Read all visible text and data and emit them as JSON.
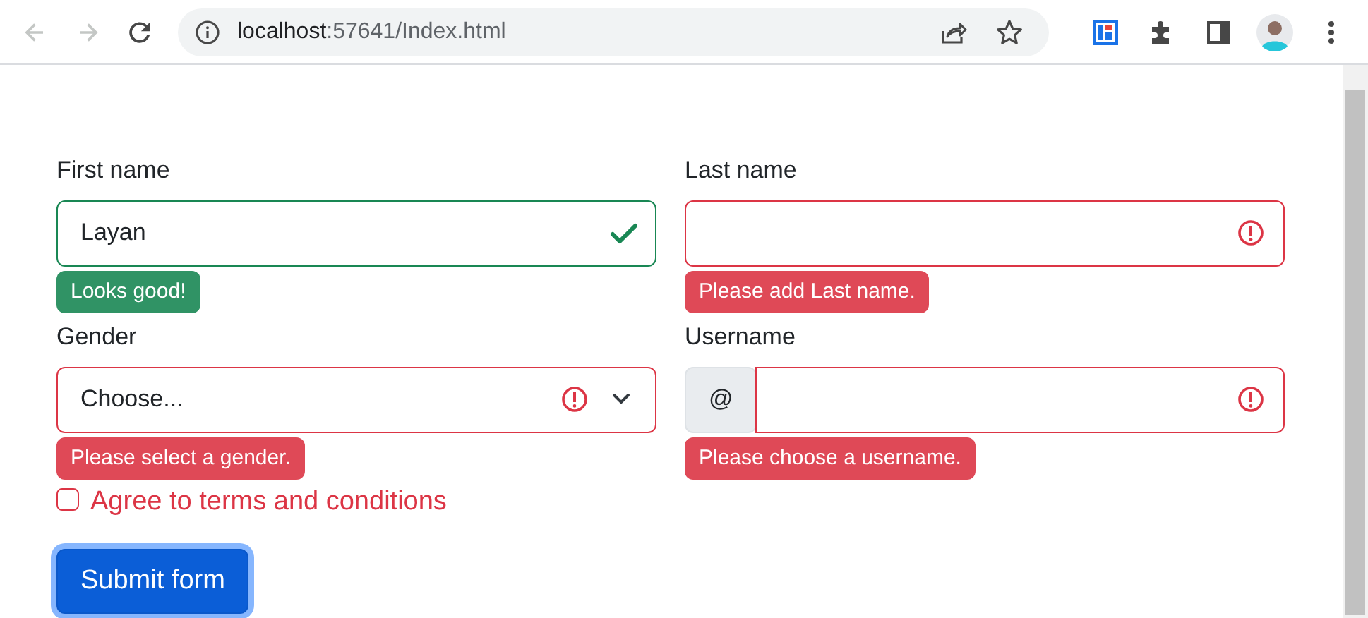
{
  "browser": {
    "back": {
      "disabled": true
    },
    "forward": {
      "disabled": true
    },
    "address": {
      "host": "localhost",
      "path": ":57641/Index.html"
    }
  },
  "form": {
    "fields": [
      {
        "kind": "text",
        "label": "First name",
        "value": "Layan",
        "valid": true,
        "feedback": "Looks good!"
      },
      {
        "kind": "text",
        "label": "Last name",
        "valid": false,
        "feedback": "Please add Last name."
      },
      {
        "kind": "select",
        "label": "Gender",
        "value": "Choose...",
        "valid": false,
        "feedback": "Please select a gender."
      },
      {
        "kind": "prefixed",
        "label": "Username",
        "prefix": "@",
        "valid": false,
        "feedback": "Please choose a username."
      }
    ],
    "checkbox": {
      "label": "Agree to terms and conditions",
      "checked": false,
      "valid": false
    },
    "submit": {
      "label": "Submit form",
      "focused": true
    }
  }
}
